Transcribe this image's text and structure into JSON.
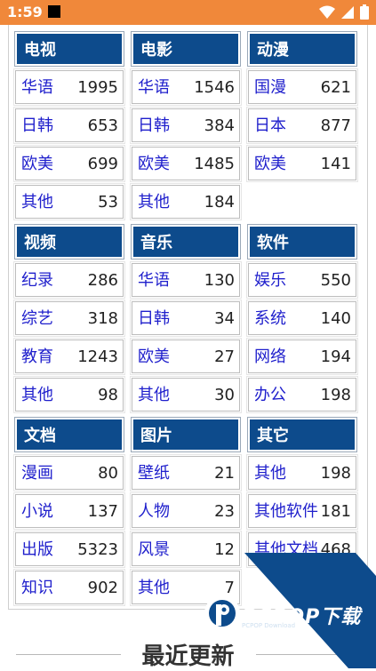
{
  "statusbar": {
    "time": "1:59"
  },
  "categories": [
    {
      "title": "电视",
      "items": [
        {
          "name": "华语",
          "count": "1995"
        },
        {
          "name": "日韩",
          "count": "653"
        },
        {
          "name": "欧美",
          "count": "699"
        },
        {
          "name": "其他",
          "count": "53"
        }
      ]
    },
    {
      "title": "电影",
      "items": [
        {
          "name": "华语",
          "count": "1546"
        },
        {
          "name": "日韩",
          "count": "384"
        },
        {
          "name": "欧美",
          "count": "1485"
        },
        {
          "name": "其他",
          "count": "184"
        }
      ]
    },
    {
      "title": "动漫",
      "items": [
        {
          "name": "国漫",
          "count": "621"
        },
        {
          "name": "日本",
          "count": "877"
        },
        {
          "name": "欧美",
          "count": "141"
        }
      ]
    },
    {
      "title": "视频",
      "items": [
        {
          "name": "纪录",
          "count": "286"
        },
        {
          "name": "综艺",
          "count": "318"
        },
        {
          "name": "教育",
          "count": "1243"
        },
        {
          "name": "其他",
          "count": "98"
        }
      ]
    },
    {
      "title": "音乐",
      "items": [
        {
          "name": "华语",
          "count": "130"
        },
        {
          "name": "日韩",
          "count": "34"
        },
        {
          "name": "欧美",
          "count": "27"
        },
        {
          "name": "其他",
          "count": "30"
        }
      ]
    },
    {
      "title": "软件",
      "items": [
        {
          "name": "娱乐",
          "count": "550"
        },
        {
          "name": "系统",
          "count": "140"
        },
        {
          "name": "网络",
          "count": "194"
        },
        {
          "name": "办公",
          "count": "198"
        }
      ]
    },
    {
      "title": "文档",
      "items": [
        {
          "name": "漫画",
          "count": "80"
        },
        {
          "name": "小说",
          "count": "137"
        },
        {
          "name": "出版",
          "count": "5323"
        },
        {
          "name": "知识",
          "count": "902"
        }
      ]
    },
    {
      "title": "图片",
      "items": [
        {
          "name": "壁纸",
          "count": "21"
        },
        {
          "name": "人物",
          "count": "23"
        },
        {
          "name": "风景",
          "count": "12"
        },
        {
          "name": "其他",
          "count": "7"
        }
      ]
    },
    {
      "title": "其它",
      "items": [
        {
          "name": "其他",
          "count": "198"
        },
        {
          "name": "其他软件",
          "count": "181"
        },
        {
          "name": "其他文档",
          "count": "468"
        }
      ]
    }
  ],
  "latest_title": "最近更新",
  "watermark": {
    "brand": "PCPOP下载",
    "sub": "PCPOP Download"
  },
  "colors": {
    "statusbar": "#f0883a",
    "header": "#0d4b8c",
    "link": "#1f1fcc",
    "watermark": "#0d4b8c"
  }
}
